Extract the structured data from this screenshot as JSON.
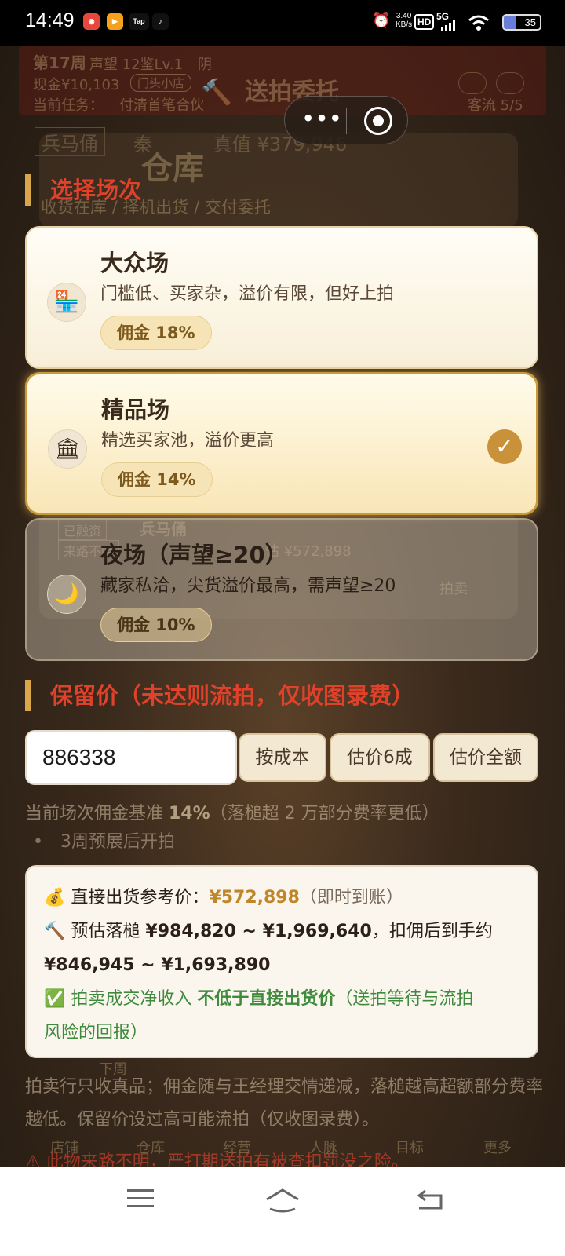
{
  "status_bar": {
    "time": "14:49",
    "net_speed_value": "3.40",
    "net_speed_unit": "KB/s",
    "hd": "HD",
    "signal": "5G",
    "battery": "35",
    "app_icons": [
      "Tap"
    ]
  },
  "background": {
    "week": "第17周",
    "reputation": "声望 12鉴Lv.1",
    "weather": "阴",
    "cash": "现金¥10,103",
    "shop": "门头小店",
    "task_label": "当前任务：",
    "task": "付清首笔合伙",
    "flow": "客流 5/5",
    "panel_title": "送拍委托",
    "item_tag": "兵马俑",
    "item_dynasty": "秦",
    "item_value": "真值 ¥379,946",
    "warehouse": "仓库",
    "tabs": "收货在库 / 择机出货 / 交付委托",
    "item2_name": "兵马俑",
    "item2_est": "估 ¥572,898",
    "tag1": "已融资",
    "tag2": "来路不明",
    "btn_auction": "拍卖",
    "next_week": "下周",
    "nav": [
      "店铺",
      "仓库",
      "经营",
      "人脉",
      "目标",
      "更多"
    ]
  },
  "capsule": {
    "more": "•••"
  },
  "section_session": {
    "title": "选择场次"
  },
  "sessions": [
    {
      "name": "大众场",
      "desc": "门槛低、买家杂，溢价有限，但好上拍",
      "fee": "佣金 18%",
      "icon": "convenience-store-icon",
      "selected": false
    },
    {
      "name": "精品场",
      "desc": "精选买家池，溢价更高",
      "fee": "佣金 14%",
      "icon": "classical-building-icon",
      "selected": true
    },
    {
      "name": "夜场（声望≥20）",
      "desc": "藏家私洽，尖货溢价最高，需声望≥20",
      "fee": "佣金 10%",
      "icon": "crescent-moon-icon",
      "selected": false
    }
  ],
  "check_mark": "✓",
  "section_reserve": {
    "title": "保留价（未达则流拍，仅收图录费）"
  },
  "reserve": {
    "value": "886338",
    "btn_cost": "按成本",
    "btn_60": "估价6成",
    "btn_full": "估价全额"
  },
  "fee_line": {
    "prefix": "当前场次佣金基准 ",
    "rate": "14%",
    "suffix": "（落槌超 2 万部分费率更低）"
  },
  "bullet": "•　3周预展后开拍",
  "info": {
    "line1_label": "💰 直接出货参考价：",
    "line1_value": "¥572,898",
    "line1_suffix": "（即时到账）",
    "line2_label": "🔨 预估落槌 ",
    "line2_range": "¥984,820 ~ ¥1,969,640",
    "line2_suffix": "，扣佣后到手约",
    "line3_range": "¥846,945 ~ ¥1,693,890",
    "line4_prefix": "✅ 拍卖成交净收入 ",
    "line4_bold": "不低于直接出货价",
    "line4_suffix": "（送拍等待与流拍",
    "line5": "风险的回报）"
  },
  "note": "拍卖行只收真品；佣金随与王经理交情递减，落槌越高超额部分费率越低。保留价设过高可能流拍（仅收图录费）。",
  "warning": "⚠ 此物来路不明，严打期送拍有被查扣罚没之险。",
  "colors": {
    "accent_red": "#e0412a",
    "gold": "#c0862a",
    "selected_border": "#c99a3c",
    "check_bg": "#c8913a",
    "green": "#3f8a3c"
  }
}
